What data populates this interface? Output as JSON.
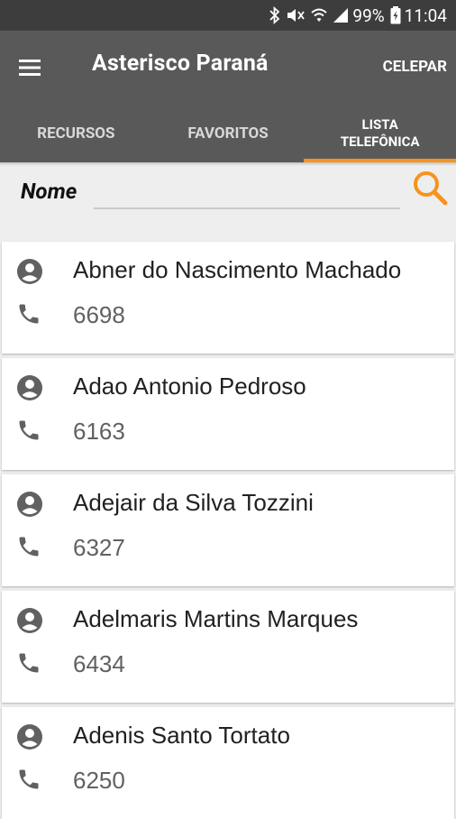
{
  "status_bar": {
    "battery": "99%",
    "time": "11:04"
  },
  "app_bar": {
    "title": "Asterisco Paraná",
    "action": "CELEPAR"
  },
  "tabs": [
    {
      "label": "RECURSOS",
      "active": false
    },
    {
      "label": "FAVORITOS",
      "active": false
    },
    {
      "label_line1": "LISTA",
      "label_line2": "TELEFÔNICA",
      "active": true
    }
  ],
  "search": {
    "label": "Nome",
    "value": "",
    "placeholder": ""
  },
  "contacts": [
    {
      "name": "Abner do Nascimento Machado",
      "extension": "6698"
    },
    {
      "name": "Adao Antonio Pedroso",
      "extension": "6163"
    },
    {
      "name": "Adejair da Silva Tozzini",
      "extension": "6327"
    },
    {
      "name": "Adelmaris Martins Marques",
      "extension": "6434"
    },
    {
      "name": "Adenis Santo Tortato",
      "extension": "6250"
    }
  ],
  "colors": {
    "app_bar": "#595959",
    "status_bar": "#3d3d3d",
    "accent": "#f7931e",
    "background": "#eeeeee"
  },
  "icons": [
    "bluetooth-icon",
    "mute-icon",
    "wifi-icon",
    "signal-icon",
    "battery-icon",
    "menu-icon",
    "search-icon",
    "person-icon",
    "phone-icon"
  ]
}
